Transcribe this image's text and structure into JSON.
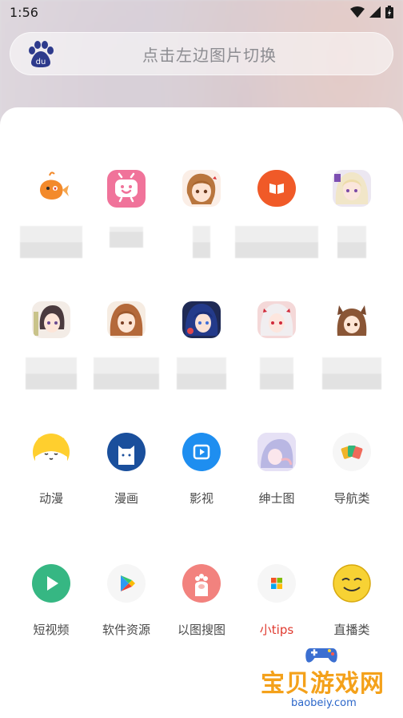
{
  "status_bar": {
    "time": "1:56"
  },
  "search": {
    "placeholder": "点击左边图片切换"
  },
  "rows": [
    {
      "tiles": [
        {
          "icon": "orange-fish-icon",
          "label": ""
        },
        {
          "icon": "pink-tv-icon",
          "label": ""
        },
        {
          "icon": "anime-avatar-icon",
          "label": ""
        },
        {
          "icon": "orange-book-icon",
          "label": ""
        },
        {
          "icon": "anime-avatar-icon",
          "label": ""
        }
      ]
    },
    {
      "tiles": [
        {
          "icon": "anime-avatar-icon",
          "label": ""
        },
        {
          "icon": "anime-avatar-icon",
          "label": ""
        },
        {
          "icon": "anime-avatar-icon",
          "label": ""
        },
        {
          "icon": "anime-avatar-icon",
          "label": ""
        },
        {
          "icon": "anime-avatar-icon",
          "label": ""
        }
      ]
    },
    {
      "tiles": [
        {
          "icon": "yellow-cat-icon",
          "label": "动漫"
        },
        {
          "icon": "blue-cat-icon",
          "label": "漫画"
        },
        {
          "icon": "video-play-icon",
          "label": "影视"
        },
        {
          "icon": "anime-avatar-icon",
          "label": "绅士图"
        },
        {
          "icon": "cards-icon",
          "label": "导航类"
        }
      ]
    },
    {
      "tiles": [
        {
          "icon": "green-play-icon",
          "label": "短视频"
        },
        {
          "icon": "play-store-icon",
          "label": "软件资源"
        },
        {
          "icon": "cat-paw-icon",
          "label": "以图搜图"
        },
        {
          "icon": "windows-logo-icon",
          "label": "小tips"
        },
        {
          "icon": "smug-face-icon",
          "label": "直播类"
        }
      ]
    }
  ],
  "watermark": {
    "title": "宝贝游戏网",
    "url": "baobeiy.com"
  },
  "colors": {
    "accent_label": "#e03a2f",
    "sheet": "#ffffff"
  }
}
